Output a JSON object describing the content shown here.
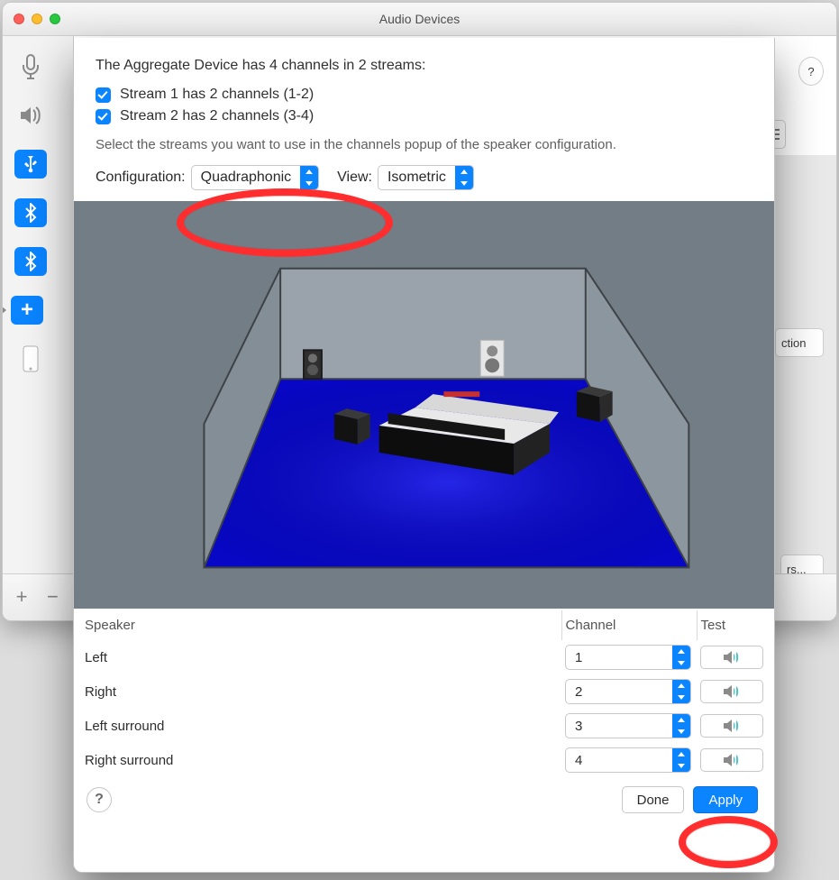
{
  "window": {
    "title": "Audio Devices"
  },
  "background": {
    "buttons": {
      "help": "?",
      "truncated_right": "ction",
      "truncated_bottom": "rs..."
    }
  },
  "sheet": {
    "heading": "The Aggregate Device has 4 channels in 2 streams:",
    "streams": [
      {
        "checked": true,
        "label": "Stream 1 has 2 channels (1-2)"
      },
      {
        "checked": true,
        "label": "Stream 2 has 2 channels (3-4)"
      }
    ],
    "hint": "Select the streams you want to use in the channels popup of the speaker configuration.",
    "config_label": "Configuration:",
    "config_value": "Quadraphonic",
    "view_label": "View:",
    "view_value": "Isometric",
    "columns": {
      "speaker": "Speaker",
      "channel": "Channel",
      "test": "Test"
    },
    "rows": [
      {
        "speaker": "Left",
        "channel": "1"
      },
      {
        "speaker": "Right",
        "channel": "2"
      },
      {
        "speaker": "Left surround",
        "channel": "3"
      },
      {
        "speaker": "Right surround",
        "channel": "4"
      }
    ],
    "footer": {
      "help": "?",
      "done": "Done",
      "apply": "Apply"
    }
  }
}
